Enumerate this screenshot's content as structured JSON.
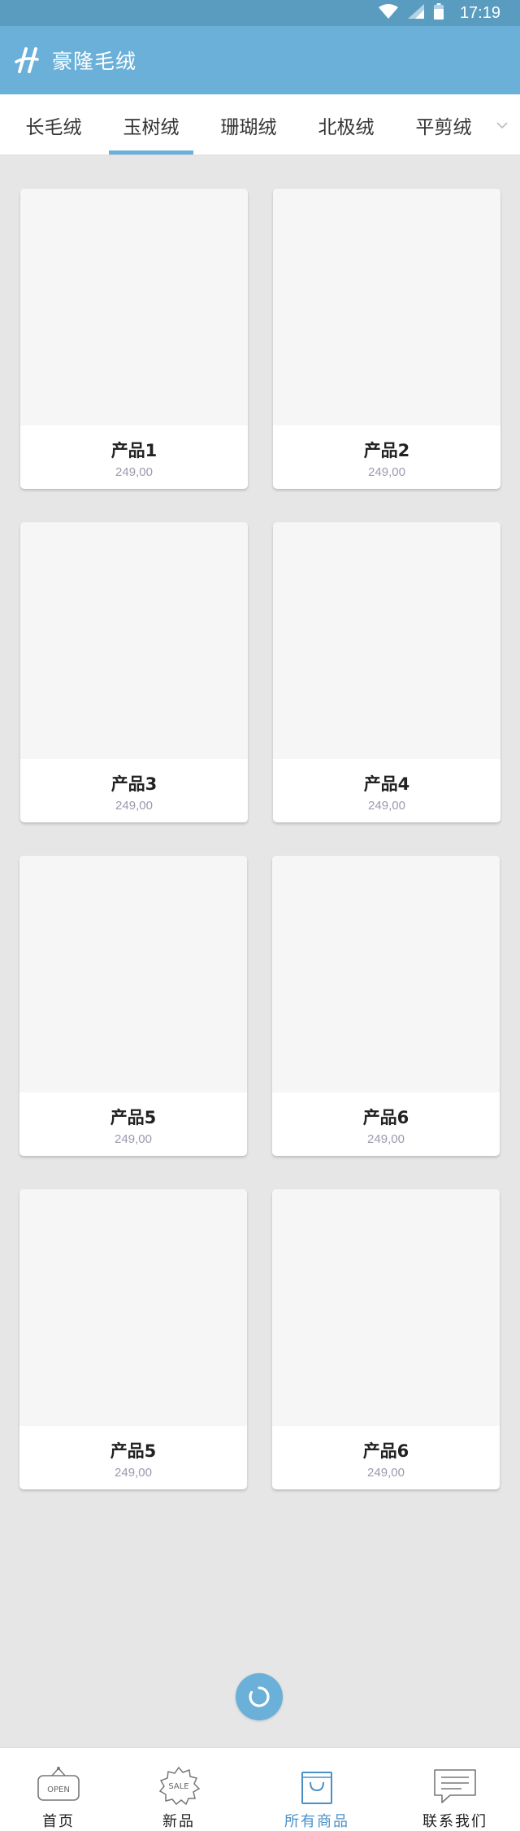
{
  "status_bar": {
    "time": "17:19"
  },
  "app_bar": {
    "title": "豪隆毛绒"
  },
  "tabs": [
    {
      "label": "长毛绒"
    },
    {
      "label": "玉树绒"
    },
    {
      "label": "珊瑚绒"
    },
    {
      "label": "北极绒"
    },
    {
      "label": "平剪绒"
    }
  ],
  "active_tab": "玉树绒",
  "products": [
    {
      "name": "产品1",
      "price": "249,00"
    },
    {
      "name": "产品2",
      "price": "249,00"
    },
    {
      "name": "产品3",
      "price": "249,00"
    },
    {
      "name": "产品4",
      "price": "249,00"
    },
    {
      "name": "产品5",
      "price": "249,00"
    },
    {
      "name": "产品6",
      "price": "249,00"
    },
    {
      "name": "产品5",
      "price": "249,00"
    },
    {
      "name": "产品6",
      "price": "249,00"
    }
  ],
  "bottom_nav": [
    {
      "label": "首页",
      "icon": "open-sign-icon",
      "icon_text": "OPEN"
    },
    {
      "label": "新品",
      "icon": "sale-badge-icon",
      "icon_text": "SALE"
    },
    {
      "label": "所有商品",
      "icon": "shopping-bag-icon"
    },
    {
      "label": "联系我们",
      "icon": "chat-bubble-icon"
    }
  ],
  "active_nav": "所有商品",
  "colors": {
    "status_bar": "#5a9cc0",
    "app_bar": "#6ab0d8",
    "accent": "#6ab0d8",
    "nav_active": "#4a90c8",
    "background": "#e6e6e6"
  }
}
